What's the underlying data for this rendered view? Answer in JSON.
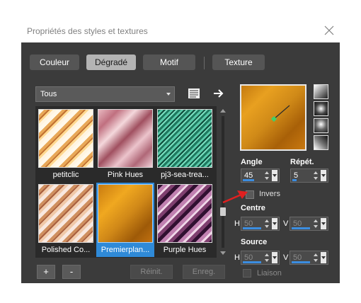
{
  "window": {
    "title": "Propriétés des styles et textures"
  },
  "tabs": [
    {
      "label": "Couleur",
      "active": false
    },
    {
      "label": "Dégradé",
      "active": true
    },
    {
      "label": "Motif",
      "active": false
    },
    {
      "label": "Texture",
      "active": false
    }
  ],
  "filter": {
    "value": "Tous"
  },
  "gradients": [
    {
      "name": "petitclic",
      "selected": false
    },
    {
      "name": "Pink Hues",
      "selected": false
    },
    {
      "name": "pj3-sea-trea...",
      "selected": false
    },
    {
      "name": "Polished Co...",
      "selected": false
    },
    {
      "name": "Premierplan...",
      "selected": true
    },
    {
      "name": "Purple Hues",
      "selected": false
    }
  ],
  "buttons": {
    "add": "+",
    "remove": "-",
    "reset": "Réinit.",
    "save": "Enreg."
  },
  "controls": {
    "angle_label": "Angle",
    "angle_value": "45",
    "repeat_label": "Répét.",
    "repeat_value": "5",
    "invert_label": "Invers",
    "center_label": "Centre",
    "center_h_label": "H",
    "center_h_value": "50",
    "center_v_label": "V",
    "center_v_value": "50",
    "source_label": "Source",
    "source_h_label": "H",
    "source_h_value": "50",
    "source_v_label": "V",
    "source_v_value": "50",
    "link_label": "Liaison"
  },
  "colors": {
    "panel": "#3b3b3b",
    "accent": "#2f8ad8",
    "annotation_arrow": "#e02020"
  }
}
